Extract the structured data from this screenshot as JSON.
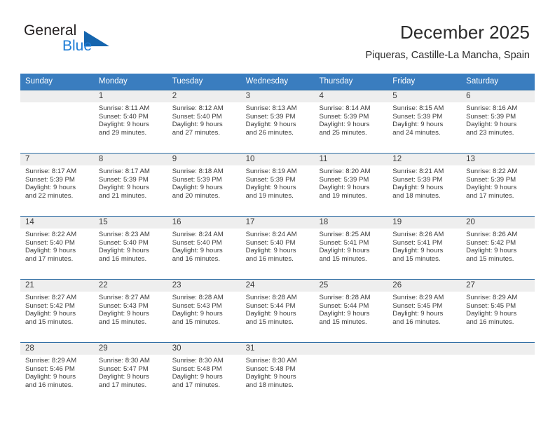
{
  "brand": {
    "name_part1": "General",
    "name_part2": "Blue",
    "accent_color": "#1565ae",
    "link_color": "#1c7cd5"
  },
  "header": {
    "title": "December 2025",
    "subtitle": "Piqueras, Castille-La Mancha, Spain"
  },
  "calendar": {
    "header_bg": "#3a7dbf",
    "daynum_bg": "#eeeeee",
    "weekdays": [
      "Sunday",
      "Monday",
      "Tuesday",
      "Wednesday",
      "Thursday",
      "Friday",
      "Saturday"
    ],
    "weeks": [
      [
        {
          "day": "",
          "sunrise": "",
          "sunset": "",
          "daylight_line1": "",
          "daylight_line2": "",
          "empty": true
        },
        {
          "day": "1",
          "sunrise": "Sunrise: 8:11 AM",
          "sunset": "Sunset: 5:40 PM",
          "daylight_line1": "Daylight: 9 hours",
          "daylight_line2": "and 29 minutes.",
          "empty": false
        },
        {
          "day": "2",
          "sunrise": "Sunrise: 8:12 AM",
          "sunset": "Sunset: 5:40 PM",
          "daylight_line1": "Daylight: 9 hours",
          "daylight_line2": "and 27 minutes.",
          "empty": false
        },
        {
          "day": "3",
          "sunrise": "Sunrise: 8:13 AM",
          "sunset": "Sunset: 5:39 PM",
          "daylight_line1": "Daylight: 9 hours",
          "daylight_line2": "and 26 minutes.",
          "empty": false
        },
        {
          "day": "4",
          "sunrise": "Sunrise: 8:14 AM",
          "sunset": "Sunset: 5:39 PM",
          "daylight_line1": "Daylight: 9 hours",
          "daylight_line2": "and 25 minutes.",
          "empty": false
        },
        {
          "day": "5",
          "sunrise": "Sunrise: 8:15 AM",
          "sunset": "Sunset: 5:39 PM",
          "daylight_line1": "Daylight: 9 hours",
          "daylight_line2": "and 24 minutes.",
          "empty": false
        },
        {
          "day": "6",
          "sunrise": "Sunrise: 8:16 AM",
          "sunset": "Sunset: 5:39 PM",
          "daylight_line1": "Daylight: 9 hours",
          "daylight_line2": "and 23 minutes.",
          "empty": false
        }
      ],
      [
        {
          "day": "7",
          "sunrise": "Sunrise: 8:17 AM",
          "sunset": "Sunset: 5:39 PM",
          "daylight_line1": "Daylight: 9 hours",
          "daylight_line2": "and 22 minutes.",
          "empty": false
        },
        {
          "day": "8",
          "sunrise": "Sunrise: 8:17 AM",
          "sunset": "Sunset: 5:39 PM",
          "daylight_line1": "Daylight: 9 hours",
          "daylight_line2": "and 21 minutes.",
          "empty": false
        },
        {
          "day": "9",
          "sunrise": "Sunrise: 8:18 AM",
          "sunset": "Sunset: 5:39 PM",
          "daylight_line1": "Daylight: 9 hours",
          "daylight_line2": "and 20 minutes.",
          "empty": false
        },
        {
          "day": "10",
          "sunrise": "Sunrise: 8:19 AM",
          "sunset": "Sunset: 5:39 PM",
          "daylight_line1": "Daylight: 9 hours",
          "daylight_line2": "and 19 minutes.",
          "empty": false
        },
        {
          "day": "11",
          "sunrise": "Sunrise: 8:20 AM",
          "sunset": "Sunset: 5:39 PM",
          "daylight_line1": "Daylight: 9 hours",
          "daylight_line2": "and 19 minutes.",
          "empty": false
        },
        {
          "day": "12",
          "sunrise": "Sunrise: 8:21 AM",
          "sunset": "Sunset: 5:39 PM",
          "daylight_line1": "Daylight: 9 hours",
          "daylight_line2": "and 18 minutes.",
          "empty": false
        },
        {
          "day": "13",
          "sunrise": "Sunrise: 8:22 AM",
          "sunset": "Sunset: 5:39 PM",
          "daylight_line1": "Daylight: 9 hours",
          "daylight_line2": "and 17 minutes.",
          "empty": false
        }
      ],
      [
        {
          "day": "14",
          "sunrise": "Sunrise: 8:22 AM",
          "sunset": "Sunset: 5:40 PM",
          "daylight_line1": "Daylight: 9 hours",
          "daylight_line2": "and 17 minutes.",
          "empty": false
        },
        {
          "day": "15",
          "sunrise": "Sunrise: 8:23 AM",
          "sunset": "Sunset: 5:40 PM",
          "daylight_line1": "Daylight: 9 hours",
          "daylight_line2": "and 16 minutes.",
          "empty": false
        },
        {
          "day": "16",
          "sunrise": "Sunrise: 8:24 AM",
          "sunset": "Sunset: 5:40 PM",
          "daylight_line1": "Daylight: 9 hours",
          "daylight_line2": "and 16 minutes.",
          "empty": false
        },
        {
          "day": "17",
          "sunrise": "Sunrise: 8:24 AM",
          "sunset": "Sunset: 5:40 PM",
          "daylight_line1": "Daylight: 9 hours",
          "daylight_line2": "and 16 minutes.",
          "empty": false
        },
        {
          "day": "18",
          "sunrise": "Sunrise: 8:25 AM",
          "sunset": "Sunset: 5:41 PM",
          "daylight_line1": "Daylight: 9 hours",
          "daylight_line2": "and 15 minutes.",
          "empty": false
        },
        {
          "day": "19",
          "sunrise": "Sunrise: 8:26 AM",
          "sunset": "Sunset: 5:41 PM",
          "daylight_line1": "Daylight: 9 hours",
          "daylight_line2": "and 15 minutes.",
          "empty": false
        },
        {
          "day": "20",
          "sunrise": "Sunrise: 8:26 AM",
          "sunset": "Sunset: 5:42 PM",
          "daylight_line1": "Daylight: 9 hours",
          "daylight_line2": "and 15 minutes.",
          "empty": false
        }
      ],
      [
        {
          "day": "21",
          "sunrise": "Sunrise: 8:27 AM",
          "sunset": "Sunset: 5:42 PM",
          "daylight_line1": "Daylight: 9 hours",
          "daylight_line2": "and 15 minutes.",
          "empty": false
        },
        {
          "day": "22",
          "sunrise": "Sunrise: 8:27 AM",
          "sunset": "Sunset: 5:43 PM",
          "daylight_line1": "Daylight: 9 hours",
          "daylight_line2": "and 15 minutes.",
          "empty": false
        },
        {
          "day": "23",
          "sunrise": "Sunrise: 8:28 AM",
          "sunset": "Sunset: 5:43 PM",
          "daylight_line1": "Daylight: 9 hours",
          "daylight_line2": "and 15 minutes.",
          "empty": false
        },
        {
          "day": "24",
          "sunrise": "Sunrise: 8:28 AM",
          "sunset": "Sunset: 5:44 PM",
          "daylight_line1": "Daylight: 9 hours",
          "daylight_line2": "and 15 minutes.",
          "empty": false
        },
        {
          "day": "25",
          "sunrise": "Sunrise: 8:28 AM",
          "sunset": "Sunset: 5:44 PM",
          "daylight_line1": "Daylight: 9 hours",
          "daylight_line2": "and 15 minutes.",
          "empty": false
        },
        {
          "day": "26",
          "sunrise": "Sunrise: 8:29 AM",
          "sunset": "Sunset: 5:45 PM",
          "daylight_line1": "Daylight: 9 hours",
          "daylight_line2": "and 16 minutes.",
          "empty": false
        },
        {
          "day": "27",
          "sunrise": "Sunrise: 8:29 AM",
          "sunset": "Sunset: 5:45 PM",
          "daylight_line1": "Daylight: 9 hours",
          "daylight_line2": "and 16 minutes.",
          "empty": false
        }
      ],
      [
        {
          "day": "28",
          "sunrise": "Sunrise: 8:29 AM",
          "sunset": "Sunset: 5:46 PM",
          "daylight_line1": "Daylight: 9 hours",
          "daylight_line2": "and 16 minutes.",
          "empty": false
        },
        {
          "day": "29",
          "sunrise": "Sunrise: 8:30 AM",
          "sunset": "Sunset: 5:47 PM",
          "daylight_line1": "Daylight: 9 hours",
          "daylight_line2": "and 17 minutes.",
          "empty": false
        },
        {
          "day": "30",
          "sunrise": "Sunrise: 8:30 AM",
          "sunset": "Sunset: 5:48 PM",
          "daylight_line1": "Daylight: 9 hours",
          "daylight_line2": "and 17 minutes.",
          "empty": false
        },
        {
          "day": "31",
          "sunrise": "Sunrise: 8:30 AM",
          "sunset": "Sunset: 5:48 PM",
          "daylight_line1": "Daylight: 9 hours",
          "daylight_line2": "and 18 minutes.",
          "empty": false
        },
        {
          "day": "",
          "sunrise": "",
          "sunset": "",
          "daylight_line1": "",
          "daylight_line2": "",
          "empty": true
        },
        {
          "day": "",
          "sunrise": "",
          "sunset": "",
          "daylight_line1": "",
          "daylight_line2": "",
          "empty": true
        },
        {
          "day": "",
          "sunrise": "",
          "sunset": "",
          "daylight_line1": "",
          "daylight_line2": "",
          "empty": true
        }
      ]
    ]
  }
}
